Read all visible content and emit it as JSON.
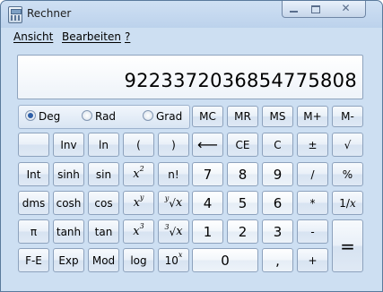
{
  "window": {
    "title": "Rechner"
  },
  "menu": {
    "view": "Ansicht",
    "edit": "Bearbeiten",
    "help": "?"
  },
  "display": {
    "value": "9223372036854775808"
  },
  "angle_mode": {
    "options": [
      "Deg",
      "Rad",
      "Grad"
    ],
    "selected": "Deg"
  },
  "memory": {
    "mc": "MC",
    "mr": "MR",
    "ms": "MS",
    "m_plus": "M+",
    "m_minus": "M-"
  },
  "keys": {
    "inv": "Inv",
    "ln": "ln",
    "open_paren": "(",
    "close_paren": ")",
    "backspace": "⟵",
    "ce": "CE",
    "c": "C",
    "plus_minus": "±",
    "sqrt": "√",
    "int": "Int",
    "sinh": "sinh",
    "sin": "sin",
    "square_base": "x",
    "square_exp": "2",
    "factorial": "n!",
    "percent": "%",
    "dms": "dms",
    "cosh": "cosh",
    "cos": "cos",
    "pow_base": "x",
    "pow_exp": "y",
    "yroot_index": "y",
    "yroot_sign": "√",
    "yroot_x": "x",
    "multiply": "*",
    "reciprocal_num": "1/",
    "reciprocal_x": "x",
    "pi": "π",
    "tanh": "tanh",
    "tan": "tan",
    "cube_base": "x",
    "cube_exp": "3",
    "cbrt_index": "3",
    "cbrt_sign": "√",
    "cbrt_x": "x",
    "subtract": "-",
    "equals": "=",
    "fe": "F-E",
    "exp": "Exp",
    "mod": "Mod",
    "log": "log",
    "ten_pow_base": "10",
    "ten_pow_exp": "x",
    "decimal": ",",
    "add": "+",
    "d0": "0",
    "d1": "1",
    "d2": "2",
    "d3": "3",
    "d4": "4",
    "d5": "5",
    "d6": "6",
    "d7": "7",
    "d8": "8",
    "d9": "9"
  }
}
